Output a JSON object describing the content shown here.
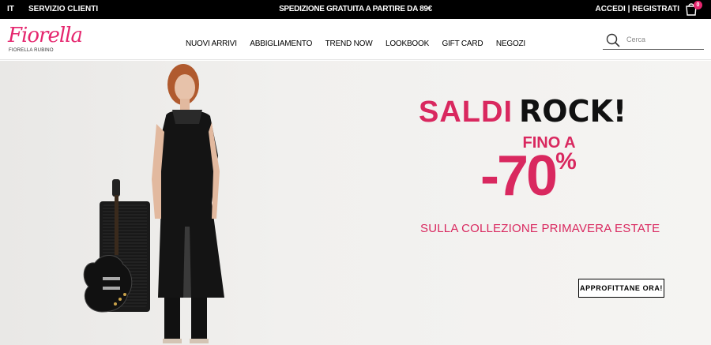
{
  "topbar": {
    "language": "IT",
    "service": "SERVIZIO CLIENTI",
    "shipping": "SPEDIZIONE GRATUITA A PARTIRE DA 89€",
    "account": "ACCEDI | REGISTRATI",
    "cart_count": "0"
  },
  "header": {
    "logo_script": "Fiorella",
    "logo_sub": "FIORELLA RUBINO",
    "nav": [
      "NUOVI ARRIVI",
      "ABBIGLIAMENTO",
      "TREND NOW",
      "LOOKBOOK",
      "GIFT CARD",
      "NEGOZI"
    ],
    "search_placeholder": "Cerca"
  },
  "hero": {
    "headline_pink": "SALDI",
    "headline_black": "ROCK!",
    "upto": "FINO A",
    "discount": "-70",
    "percent": "%",
    "collection": "SULLA COLLEZIONE PRIMAVERA ESTATE",
    "cta": "APPROFITTANE ORA!"
  },
  "colors": {
    "brand_pink": "#d9285f",
    "badge_pink": "#e5266e"
  }
}
